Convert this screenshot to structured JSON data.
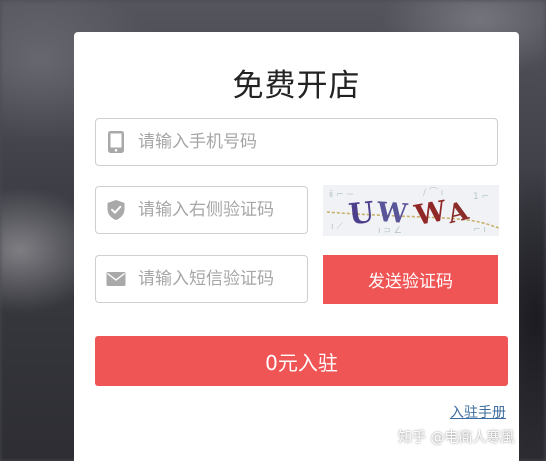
{
  "form": {
    "title": "免费开店",
    "phone": {
      "placeholder": "请输入手机号码",
      "icon": "phone-icon"
    },
    "captcha_input": {
      "placeholder": "请输入右侧验证码",
      "icon": "shield-icon"
    },
    "captcha_image": {
      "text": "UWWA"
    },
    "sms_input": {
      "placeholder": "请输入短信验证码",
      "icon": "mail-icon"
    },
    "send_code_label": "发送验证码",
    "submit_label": "0元入驻",
    "manual_link": "入驻手册"
  },
  "watermark": "知乎 @电商人寒風",
  "colors": {
    "accent": "#f05556",
    "icon": "#a9a9a9",
    "link": "#3d6d9e",
    "input_border": "#cfcfcf"
  }
}
